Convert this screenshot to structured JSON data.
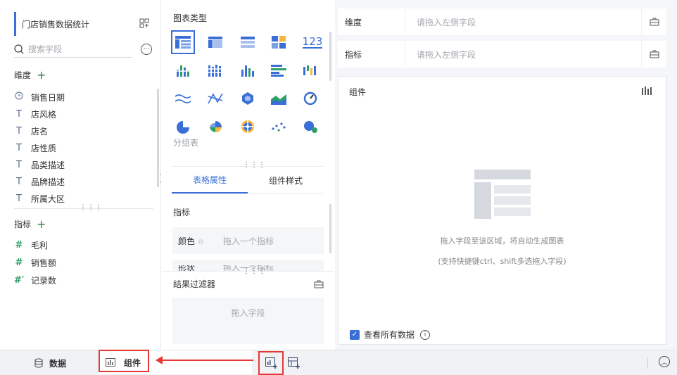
{
  "data_panel": {
    "dataset_name": "门店销售数据统计",
    "search_placeholder": "搜索字段",
    "dimension_header": "维度",
    "dimensions": [
      {
        "label": "销售日期",
        "icon": "clock-icon"
      },
      {
        "label": "店风格",
        "icon": "text-type-icon"
      },
      {
        "label": "店名",
        "icon": "text-type-icon"
      },
      {
        "label": "店性质",
        "icon": "text-type-icon"
      },
      {
        "label": "品类描述",
        "icon": "text-type-icon"
      },
      {
        "label": "品牌描述",
        "icon": "text-type-icon"
      },
      {
        "label": "所属大区",
        "icon": "text-type-icon"
      }
    ],
    "measure_header": "指标",
    "measures": [
      {
        "label": "毛利",
        "icon": "hash-icon"
      },
      {
        "label": "销售额",
        "icon": "hash-icon"
      },
      {
        "label": "记录数",
        "icon": "hash-star-icon"
      }
    ]
  },
  "config_panel": {
    "chart_type_title": "图表类型",
    "chart_type_caption": "分组表",
    "tabs": [
      "表格属性",
      "组件样式"
    ],
    "metric_label": "指标",
    "color_label": "颜色",
    "color_placeholder": "拖入一个指标",
    "shape_label": "形状",
    "shape_placeholder": "拖入一个指标",
    "filter_title": "结果过滤器",
    "filter_placeholder": "拖入字段"
  },
  "canvas": {
    "dimension_label": "维度",
    "dimension_placeholder": "请拖入左侧字段",
    "metric_label": "指标",
    "metric_placeholder": "请拖入左侧字段",
    "widget_title": "组件",
    "empty_message": "拖入字段至该区域，将自动生成图表",
    "empty_hint": "(支持快捷键ctrl、shift多选拖入字段)",
    "view_all_label": "查看所有数据",
    "view_all_checked": true
  },
  "bottom_bar": {
    "data_tab": "数据",
    "component_tab": "组件"
  },
  "colors": {
    "accent": "#3a6fd8",
    "annotation_red": "#e53935",
    "measure_green": "#2e9f6a"
  }
}
